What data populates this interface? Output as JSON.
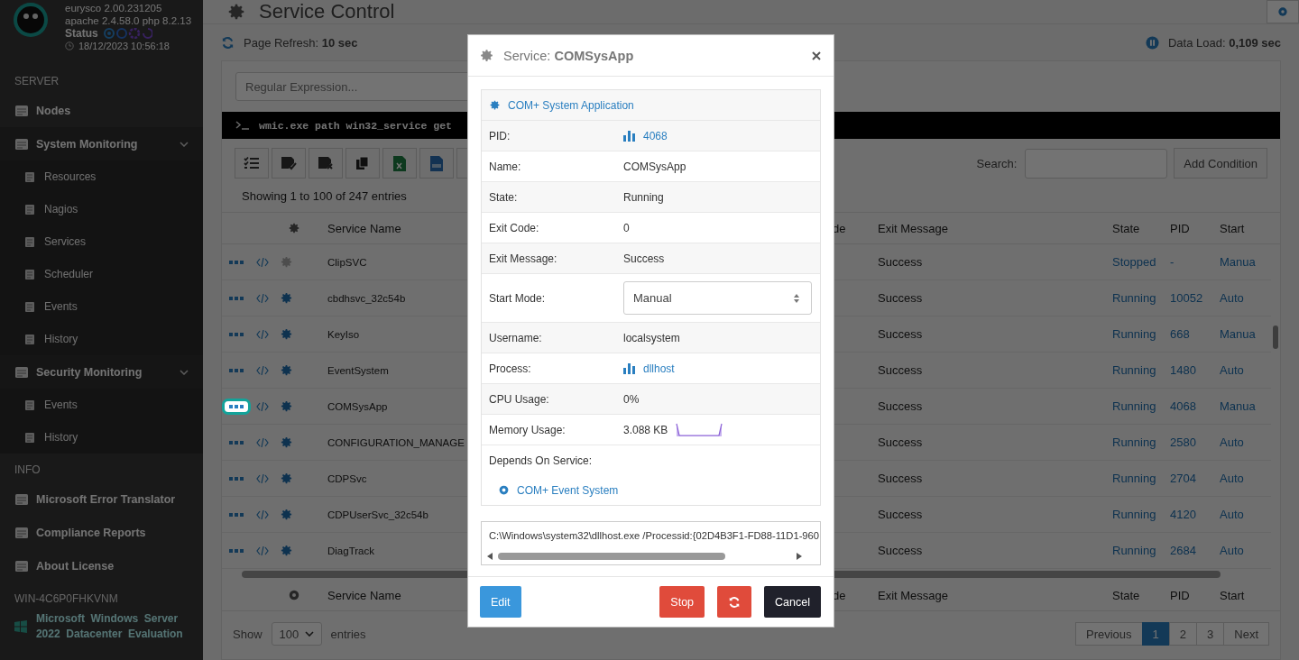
{
  "sidebar": {
    "version": "eurysco 2.00.231205",
    "server_info": "apache 2.4.58.0  php 8.2.13",
    "status_label": "Status",
    "timestamp": "18/12/2023 10:56:18",
    "sections": [
      {
        "title": "SERVER",
        "items": [
          {
            "label": "Nodes"
          },
          {
            "label": "System Monitoring",
            "expanded": true,
            "children": [
              {
                "label": "Resources"
              },
              {
                "label": "Nagios"
              },
              {
                "label": "Services"
              },
              {
                "label": "Scheduler"
              },
              {
                "label": "Events"
              },
              {
                "label": "History"
              }
            ]
          },
          {
            "label": "Security Monitoring",
            "expanded": true,
            "children": [
              {
                "label": "Events"
              },
              {
                "label": "History"
              }
            ]
          }
        ]
      },
      {
        "title": "INFO",
        "items": [
          {
            "label": "Microsoft Error Translator"
          },
          {
            "label": "Compliance Reports"
          },
          {
            "label": "About License"
          }
        ]
      }
    ],
    "host": {
      "name": "WIN-4C6P0FHKVNM",
      "os": "Microsoft  Windows  Server 2022  Datacenter  Evaluation"
    }
  },
  "page": {
    "title": "Service Control",
    "refresh": "Page Refresh: **10 sec**",
    "data_load": "Data Load: **0,109 sec**"
  },
  "table": {
    "regex_placeholder": "Regular Expression...",
    "command": "wmic.exe path win32_service get",
    "search_label": "Search:",
    "add_condition": "Add Condition",
    "info": "Showing 1 to 100 of 247 entries",
    "columns": [
      "Service Name",
      "de",
      "Exit Message",
      "State",
      "PID",
      "Start"
    ],
    "rows": [
      {
        "name": "ClipSVC",
        "active": false,
        "selected": false,
        "exit_message": "Success",
        "state": "Stopped",
        "pid": "-",
        "start": "Manua"
      },
      {
        "name": "cbdhsvc_32c54b",
        "active": true,
        "selected": false,
        "exit_message": "Success",
        "state": "Running",
        "pid": "10052",
        "start": "Auto"
      },
      {
        "name": "KeyIso",
        "active": true,
        "selected": false,
        "exit_message": "Success",
        "state": "Running",
        "pid": "668",
        "start": "Manua"
      },
      {
        "name": "EventSystem",
        "active": true,
        "selected": false,
        "exit_message": "Success",
        "state": "Running",
        "pid": "1480",
        "start": "Auto"
      },
      {
        "name": "COMSysApp",
        "active": true,
        "selected": true,
        "exit_message": "Success",
        "state": "Running",
        "pid": "4068",
        "start": "Manua"
      },
      {
        "name": "CONFIGURATION_MANAGE",
        "active": true,
        "selected": false,
        "exit_message": "Success",
        "state": "Running",
        "pid": "2580",
        "start": "Auto"
      },
      {
        "name": "CDPSvc",
        "active": true,
        "selected": false,
        "exit_message": "Success",
        "state": "Running",
        "pid": "2704",
        "start": "Auto"
      },
      {
        "name": "CDPUserSvc_32c54b",
        "active": true,
        "selected": false,
        "exit_message": "Success",
        "state": "Running",
        "pid": "4120",
        "start": "Auto"
      },
      {
        "name": "DiagTrack",
        "active": true,
        "selected": false,
        "exit_message": "Success",
        "state": "Running",
        "pid": "2684",
        "start": "Auto"
      }
    ],
    "footer_columns": [
      "Service Name",
      "de",
      "Exit Message",
      "State",
      "PID",
      "Start"
    ],
    "length_before": "Show",
    "length_value": "100",
    "length_after": "entries",
    "pagination": [
      {
        "label": "Previous",
        "selected": false
      },
      {
        "label": "1",
        "selected": true
      },
      {
        "label": "2",
        "selected": false
      },
      {
        "label": "3",
        "selected": false
      },
      {
        "label": "Next",
        "selected": false
      }
    ]
  },
  "modal": {
    "title": "Service: **COMSysApp**",
    "display_name": "COM+ System Application",
    "fields": [
      {
        "kind": "link",
        "label": "PID:",
        "value": "4068"
      },
      {
        "kind": "text",
        "label": "Name:",
        "value": "COMSysApp"
      },
      {
        "kind": "text",
        "label": "State:",
        "value": "Running"
      },
      {
        "kind": "text",
        "label": "Exit Code:",
        "value": "0"
      },
      {
        "kind": "text",
        "label": "Exit Message:",
        "value": "Success"
      },
      {
        "kind": "select",
        "label": "Start Mode:",
        "value": "Manual"
      },
      {
        "kind": "text",
        "label": "Username:",
        "value": "localsystem"
      },
      {
        "kind": "link",
        "label": "Process:",
        "value": "dllhost"
      },
      {
        "kind": "text",
        "label": "CPU Usage:",
        "value": "0%"
      },
      {
        "kind": "sparkline",
        "label": "Memory Usage:",
        "value": "3.088 KB"
      },
      {
        "kind": "depends",
        "label": "Depends On Service:",
        "value": "COM+ Event System"
      }
    ],
    "command_line": "C:\\Windows\\system32\\dllhost.exe /Processid:{02D4B3F1-FD88-11D1-960",
    "buttons": [
      {
        "kind": "primary",
        "label": "Edit"
      },
      {
        "kind": "danger",
        "label": "Stop"
      },
      {
        "kind": "refresh"
      },
      {
        "kind": "dark",
        "label": "Cancel"
      }
    ]
  }
}
